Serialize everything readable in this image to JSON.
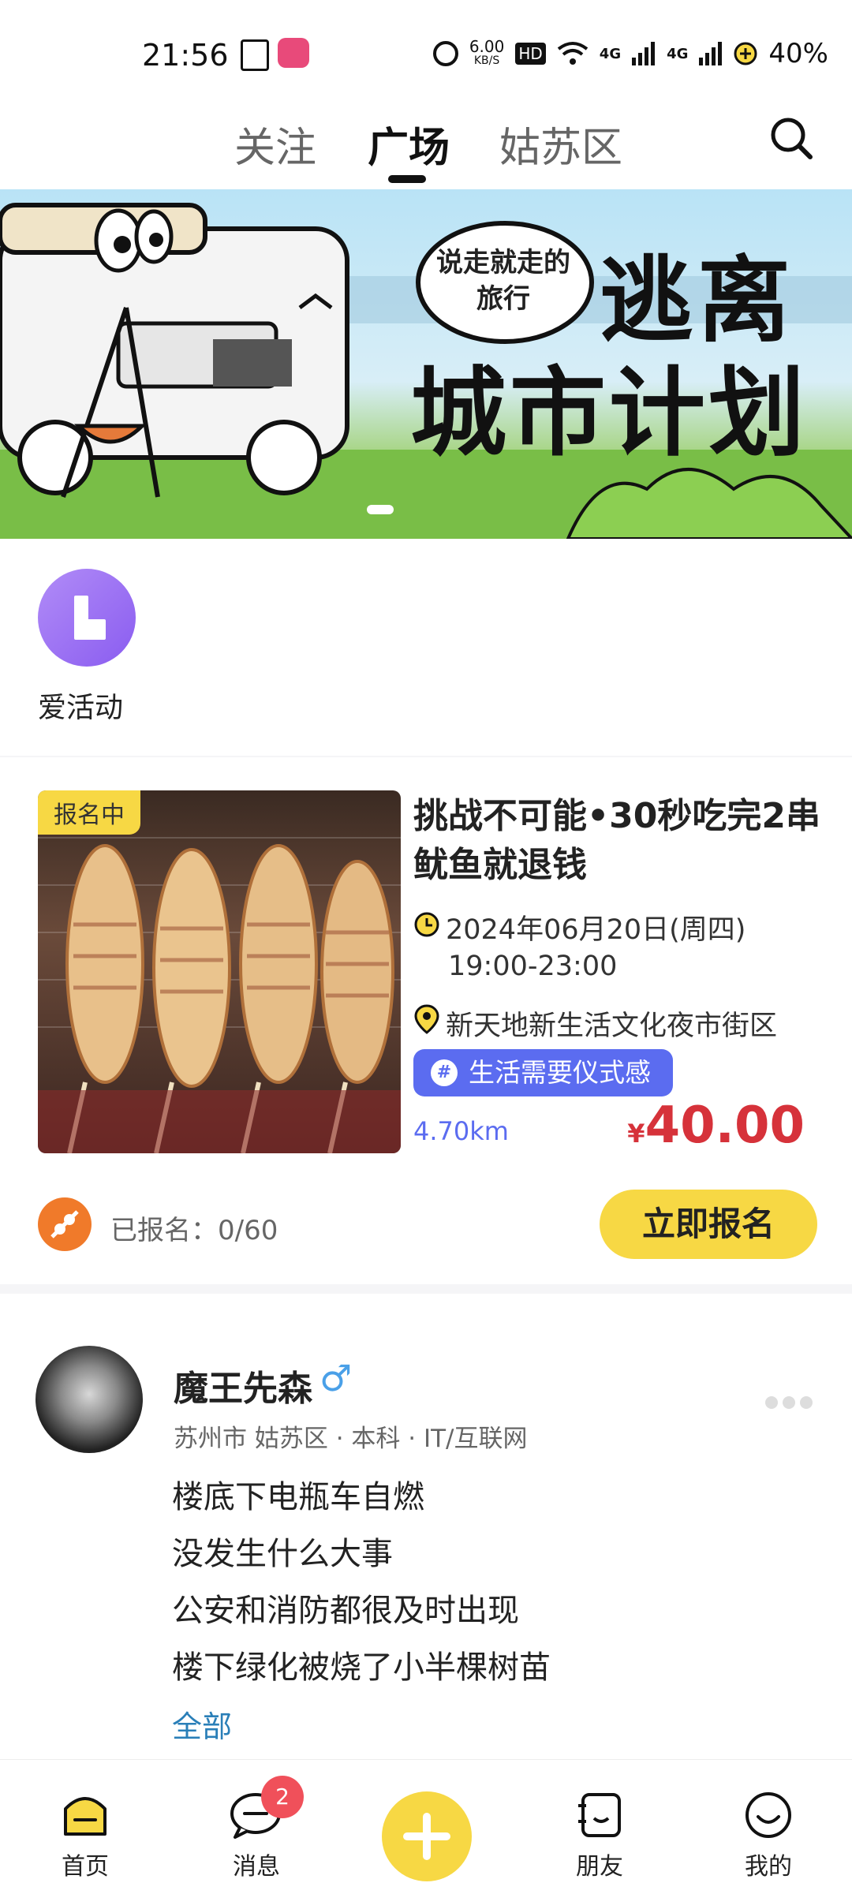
{
  "status_bar": {
    "time": "21:56",
    "speed_value": "6.00",
    "speed_unit": "KB/S",
    "hd": "HD",
    "signal1": "4G",
    "signal2": "4G",
    "battery": "40%"
  },
  "top_tabs": [
    "关注",
    "广场",
    "姑苏区"
  ],
  "active_tab": "广场",
  "banner": {
    "bubble": "说走就走的旅行",
    "title_line1": "逃离",
    "title_line2": "城市计划"
  },
  "activity_entry": {
    "label": "爱活动"
  },
  "event": {
    "badge": "报名中",
    "title": "挑战不可能•30秒吃完2串鱿鱼就退钱",
    "date": "2024年06月20日(周四)",
    "time": "19:00-23:00",
    "location": "新天地新生活文化夜市街区",
    "tag": "生活需要仪式感",
    "distance": "4.70km",
    "price_symbol": "¥",
    "price": "40.00",
    "signup_count": "已报名：0/60",
    "signup_button": "立即报名"
  },
  "post": {
    "username": "魔王先森",
    "gender_icon": "♂",
    "meta": "苏州市 姑苏区 · 本科 · IT/互联网",
    "lines": [
      "楼底下电瓶车自燃",
      "没发生什么大事",
      "公安和消防都很及时出现",
      "楼下绿化被烧了小半棵树苗"
    ],
    "expand": "全部"
  },
  "bottom_nav": {
    "home": "首页",
    "messages": "消息",
    "messages_badge": "2",
    "friends": "朋友",
    "mine": "我的"
  },
  "colors": {
    "brand_yellow": "#f7d844",
    "price_red": "#d6323a",
    "tag_blue": "#5b6cf0",
    "activity_purple": "#9b6bf2"
  }
}
